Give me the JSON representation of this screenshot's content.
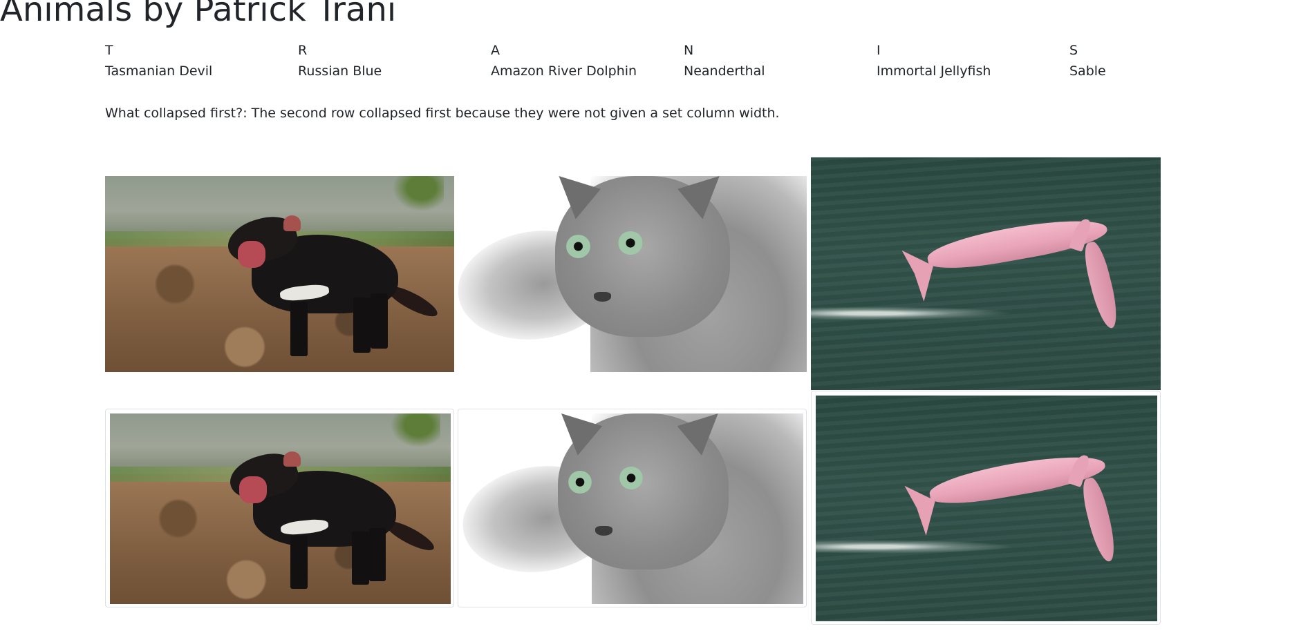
{
  "page": {
    "title": "Animals by Patrick Trani"
  },
  "letters": [
    "T",
    "R",
    "A",
    "N",
    "I",
    "S"
  ],
  "animals": [
    "Tasmanian Devil",
    "Russian Blue",
    "Amazon River Dolphin",
    "Neanderthal",
    "Immortal Jellyfish",
    "Sable"
  ],
  "note": "What collapsed first?: The second row collapsed first because they were not given a set column width.",
  "images": {
    "top": [
      "tasmanian-devil-photo",
      "russian-blue-photo",
      "amazon-river-dolphin-photo"
    ],
    "thumbnails": [
      "tasmanian-devil-thumbnail",
      "russian-blue-thumbnail",
      "amazon-river-dolphin-thumbnail"
    ]
  },
  "colors": {
    "text": "#212529",
    "thumbnail_border": "#dee2e6",
    "background": "#ffffff"
  }
}
